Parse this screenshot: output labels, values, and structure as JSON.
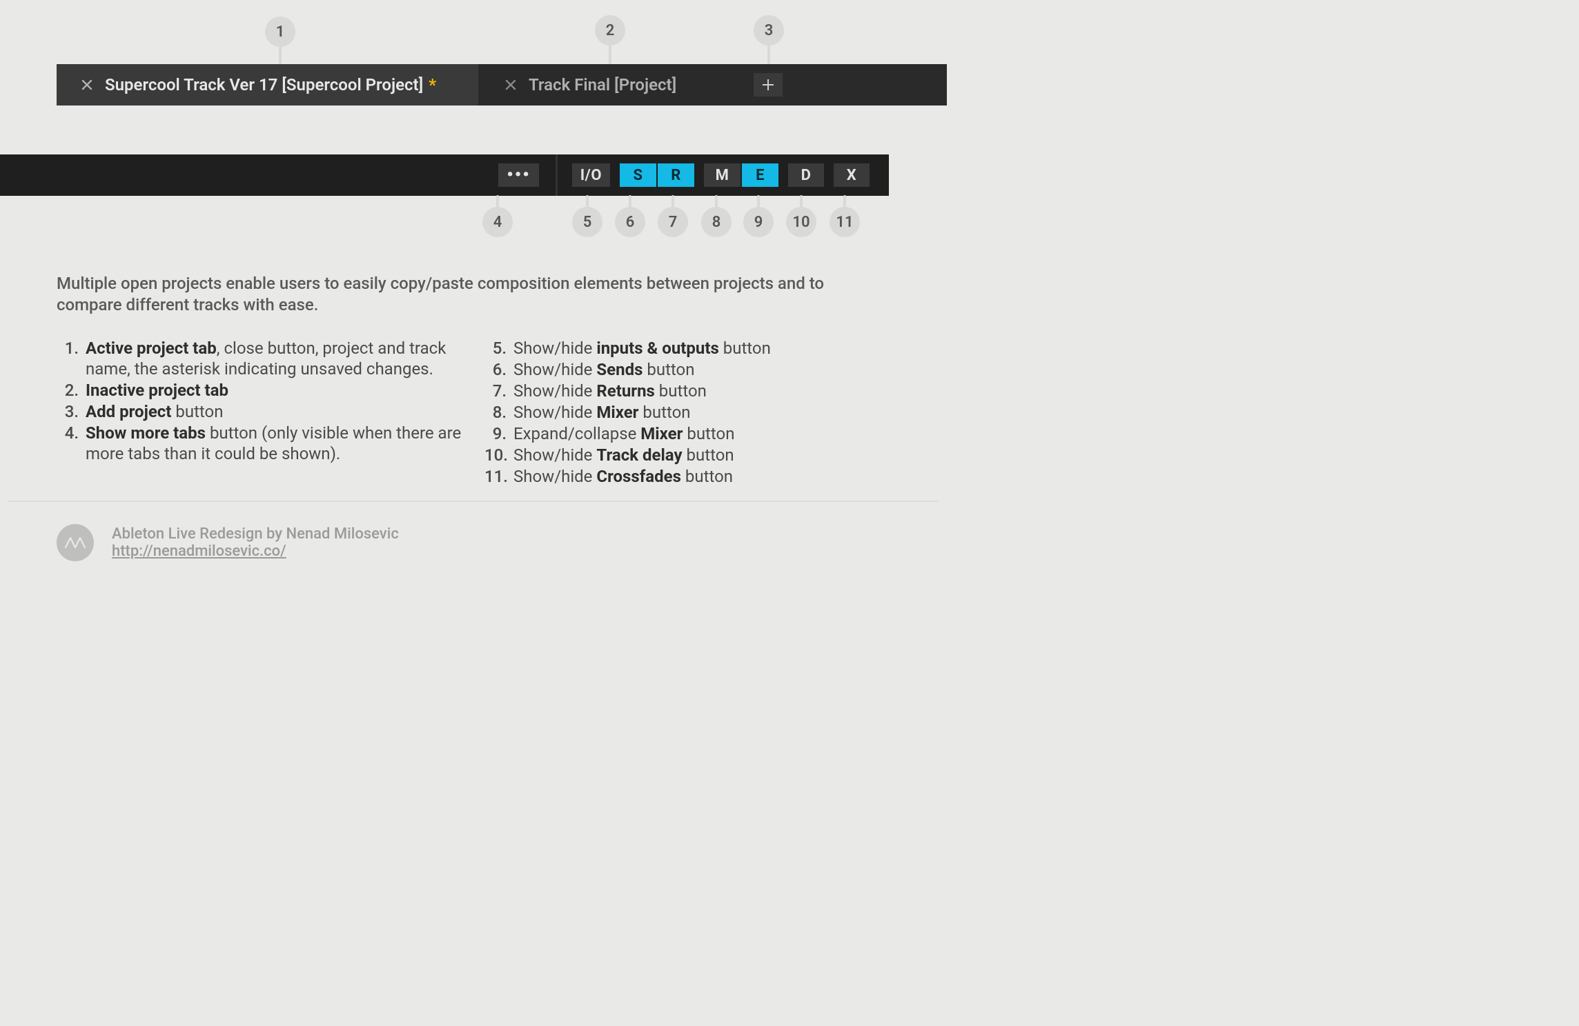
{
  "markers": [
    "1",
    "2",
    "3",
    "4",
    "5",
    "6",
    "7",
    "8",
    "9",
    "10",
    "11"
  ],
  "tabs": {
    "active": {
      "title": "Supercool Track Ver 17 [Supercool Project]",
      "dirty": "*"
    },
    "inactive": {
      "title": "Track Final [Project]"
    }
  },
  "toolbar": {
    "more": "•••",
    "io": "I/O",
    "s": "S",
    "r": "R",
    "m": "M",
    "e": "E",
    "d": "D",
    "x": "X"
  },
  "description": "Multiple open projects enable users to easily copy/paste composition elements between projects and to compare different tracks with ease.",
  "legend_left": [
    {
      "n": "1.",
      "html": "<b>Active project tab</b>, close button, project and track name, the asterisk indicating unsaved changes."
    },
    {
      "n": "2.",
      "html": "<b>Inactive project tab</b>"
    },
    {
      "n": "3.",
      "html": "<b>Add project</b> button"
    },
    {
      "n": "4.",
      "html": "<b>Show more tabs</b> button (only visible when there are more tabs than it could be shown)."
    }
  ],
  "legend_right": [
    {
      "n": "5.",
      "html": "Show/hide <b>inputs &amp; outputs</b> button"
    },
    {
      "n": "6.",
      "html": "Show/hide <b>Sends</b> button"
    },
    {
      "n": "7.",
      "html": "Show/hide <b>Returns</b> button"
    },
    {
      "n": "8.",
      "html": "Show/hide <b>Mixer</b> button"
    },
    {
      "n": "9.",
      "html": "Expand/collapse <b>Mixer</b> button"
    },
    {
      "n": "10.",
      "html": "Show/hide <b>Track delay</b> button"
    },
    {
      "n": "11.",
      "html": "Show/hide <b>Crossfades</b> button"
    }
  ],
  "footer": {
    "credit": "Ableton Live Redesign by Nenad Milosevic",
    "url": "http://nenadmilosevic.co/"
  }
}
